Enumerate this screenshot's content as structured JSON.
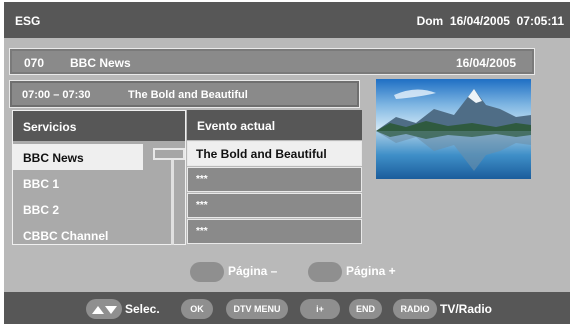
{
  "header": {
    "title": "ESG",
    "datetime": "Dom  16/04/2005  07:05:11"
  },
  "channel_bar": {
    "number": "070",
    "name": "BBC News",
    "date": "16/04/2005"
  },
  "program_bar": {
    "time": "07:00 – 07:30",
    "title": "The Bold and Beautiful"
  },
  "services": {
    "header": "Servicios",
    "items": [
      {
        "label": "BBC News",
        "selected": true
      },
      {
        "label": "BBC 1",
        "selected": false
      },
      {
        "label": "BBC 2",
        "selected": false
      },
      {
        "label": "CBBC Channel",
        "selected": false
      }
    ]
  },
  "events": {
    "header": "Evento actual",
    "items": [
      {
        "label": "The Bold and Beautiful",
        "selected": true
      },
      {
        "label": "***",
        "selected": false
      },
      {
        "label": "***",
        "selected": false
      },
      {
        "label": "***",
        "selected": false
      }
    ]
  },
  "pager": {
    "prev_label": "Página –",
    "next_label": "Página +"
  },
  "footer": {
    "select_label": "Selec.",
    "ok_label": "OK",
    "dtv_menu_label": "DTV MENU",
    "info_label": "i+",
    "end_label": "END",
    "radio_label": "RADIO",
    "tv_radio_label": "TV/Radio"
  },
  "colors": {
    "panel": "#b9b9b9",
    "bar": "#575757",
    "selected_row": "#efefef"
  }
}
